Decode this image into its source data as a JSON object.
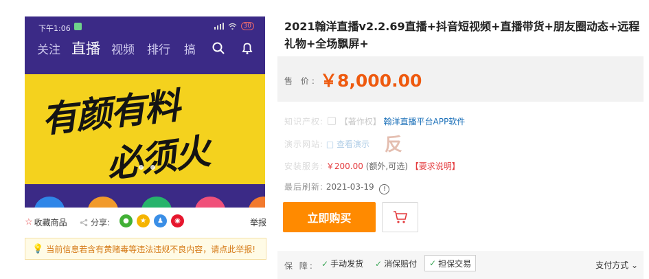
{
  "product_image": {
    "status_time": "下午1:06",
    "battery": "30",
    "nav_tabs": [
      "关注",
      "直播",
      "视频",
      "排行",
      "搞"
    ],
    "active_tab": "直播",
    "slogan_line1": "有颜有料",
    "slogan_line2": "必须火"
  },
  "image_actions": {
    "favorite_label": "收藏商品",
    "share_label": "分享:",
    "report_label": "举报"
  },
  "notice": {
    "text": "当前信息若含有黄赌毒等违法违规不良内容，请点此举报!"
  },
  "product": {
    "title": "2021翰洋直播v2.2.69直播+抖音短视频+直播带货+朋友圈动态+远程礼物+全场飘屏+",
    "price_label": "售 价:",
    "price": "￥8,000.00"
  },
  "info": {
    "ip_label": "知识产权:",
    "ip_tag": "【著作权】",
    "ip_value": "翰洋直播平台APP软件",
    "demo_label": "演示网站:",
    "demo_value": "查看演示",
    "install_label": "安装服务:",
    "install_price": "￥200.00",
    "install_note": "(额外,可选)",
    "install_link": "【要求说明】",
    "refresh_label": "最后刷新:",
    "refresh_date": "2021-03-19",
    "refresh_icon": "clock-icon"
  },
  "watermark": "反",
  "actions": {
    "buy_label": "立即购买",
    "cart_icon": "cart-icon"
  },
  "guarantee": {
    "label": "保 障:",
    "items": [
      "手动发货",
      "消保赔付",
      "担保交易"
    ],
    "pay_method": "支付方式"
  },
  "colors": {
    "accent_orange": "#ff8a00",
    "price_orange": "#ee5a0f",
    "link_blue": "#1a6fb8",
    "alert_red": "#e4393c",
    "banner_yellow": "#f4d21e",
    "phone_purple": "#3b2a86"
  }
}
